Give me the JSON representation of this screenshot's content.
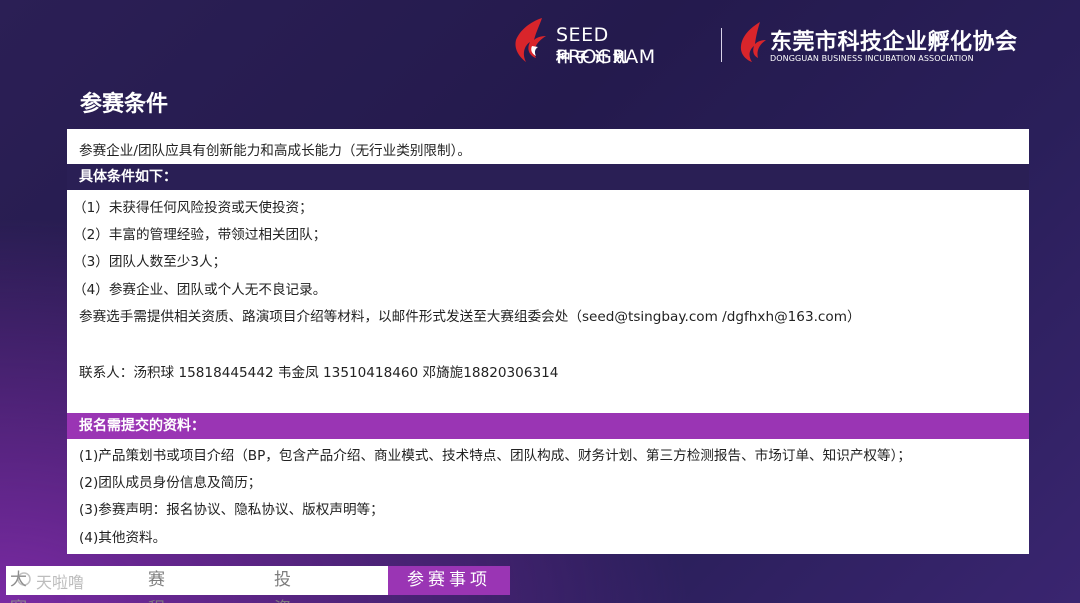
{
  "header": {
    "seed_logo_en": "SEED PROGRAM",
    "seed_logo_cn": "种子计划",
    "association_cn": "东莞市科技企业孵化协会",
    "association_en": "DONGGUAN BUSINESS INCUBATION ASSOCIATION"
  },
  "page_title": "参赛条件",
  "intro": "参赛企业/团队应具有创新能力和高成长能力（无行业类别限制）。",
  "conditions": {
    "heading": "具体条件如下：",
    "items": [
      "（1）未获得任何风险投资或天使投资；",
      "（2）丰富的管理经验，带领过相关团队；",
      "（3）团队人数至少3人；",
      "（4）参赛企业、团队或个人无不良记录。"
    ],
    "submission": "参赛选手需提供相关资质、路演项目介绍等材料，以邮件形式发送至大赛组委会处（seed@tsingbay.com /dgfhxh@163.com）",
    "contacts": "联系人：汤积球 15818445442  韦金凤 13510418460  邓旖旎18820306314"
  },
  "materials": {
    "heading": "报名需提交的资料：",
    "items": [
      "(1)产品策划书或项目介绍（BP，包含产品介绍、商业模式、技术特点、团队构成、财务计划、第三方检测报告、市场订单、知识产权等）；",
      "(2)团队成员身份信息及简历；",
      "(3)参赛声明：报名协议、隐私协议、版权声明等；",
      "(4)其他资料。"
    ]
  },
  "nav": {
    "items": [
      "大赛介绍",
      "赛程安排",
      "投资资金"
    ],
    "active": "参赛事项"
  },
  "watermark": "天啦噜",
  "colors": {
    "brand_red": "#d9252b",
    "bar_dark": "#2a1f55",
    "accent_purple": "#9a35b4",
    "background": "#2b1f55"
  }
}
